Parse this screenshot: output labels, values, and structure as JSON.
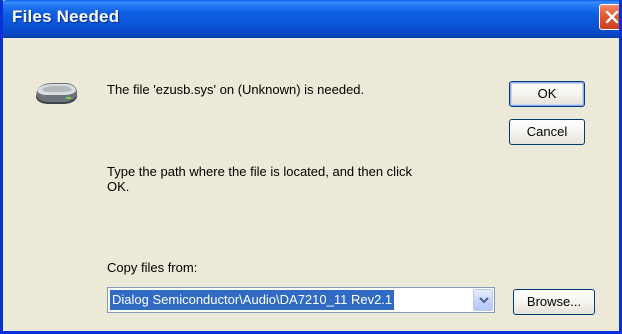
{
  "window": {
    "title": "Files Needed"
  },
  "dialog": {
    "message_needed": "The file 'ezusb.sys' on (Unknown) is needed.",
    "instructions_line1": "Type the path where the file is located, and then click",
    "instructions_line2": "OK.",
    "copy_label": "Copy files from:",
    "copy_from_value": "Dialog Semiconductor\\Audio\\DA7210_11 Rev2.1"
  },
  "buttons": {
    "ok_label": "OK",
    "cancel_label": "Cancel",
    "browse_label": "Browse..."
  },
  "icons": {
    "disk": "disk-drive-icon",
    "close": "close-icon",
    "dropdown": "chevron-down-icon"
  },
  "colors": {
    "titlebar": "#0a55d6",
    "window_bg": "#ece9d8",
    "selection": "#316ac5",
    "close_button": "#e25a34"
  }
}
